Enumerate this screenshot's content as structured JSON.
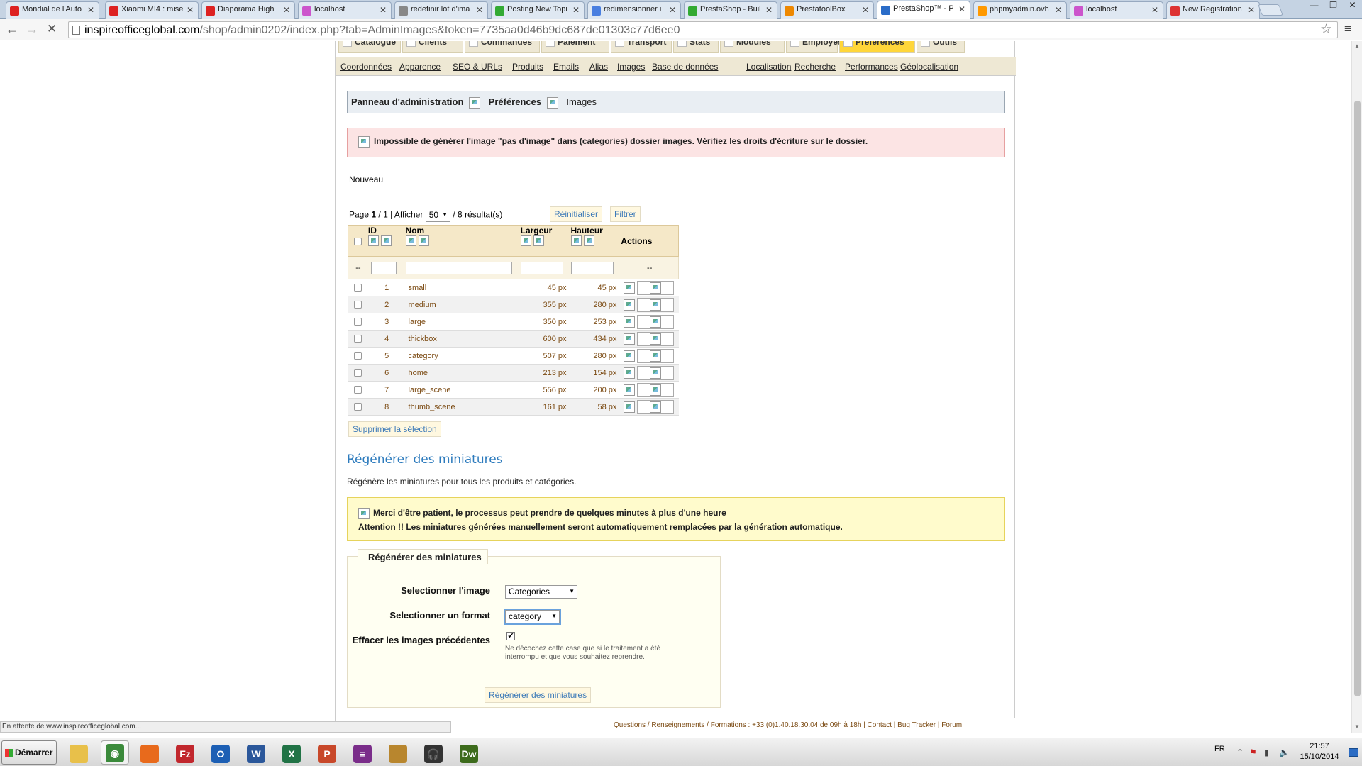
{
  "browser": {
    "tabs": [
      {
        "title": "Mondial de l'Auto",
        "favicon_color": "#d22"
      },
      {
        "title": "Xiaomi MI4 : mise",
        "favicon_color": "#d22"
      },
      {
        "title": "Diaporama High",
        "favicon_color": "#d22"
      },
      {
        "title": "localhost",
        "favicon_color": "#c5c"
      },
      {
        "title": "redefinir lot d'ima",
        "favicon_color": "#888"
      },
      {
        "title": "Posting New Topi",
        "favicon_color": "#3a3"
      },
      {
        "title": "redimensionner i",
        "favicon_color": "#4a7fe0"
      },
      {
        "title": "PrestaShop - Buil",
        "favicon_color": "#3a3"
      },
      {
        "title": "PrestatoolBox",
        "favicon_color": "#e80"
      },
      {
        "title": "PrestaShop™ - P",
        "favicon_color": "#2a6cc8"
      },
      {
        "title": "phpmyadmin.ovh",
        "favicon_color": "#f90"
      },
      {
        "title": "localhost",
        "favicon_color": "#c5c"
      },
      {
        "title": "New Registration",
        "favicon_color": "#d33"
      }
    ],
    "active_tab_index": 9,
    "close_glyph": "✕",
    "url_host": "inspireofficeglobal.com",
    "url_path": "/shop/admin0202/index.php?tab=AdminImages&token=7735aa0d46b9dc687de01303c77d6ee0",
    "status": "En attente de www.inspireofficeglobal.com..."
  },
  "admin": {
    "main_tabs": [
      "Catalogue",
      "Clients",
      "Commandes",
      "Paiement",
      "Transport",
      "Stats",
      "Modules",
      "Employés",
      "Préférences",
      "Outils"
    ],
    "active_main_tab": "Préférences",
    "sub_tabs": [
      "Coordonnées",
      "Apparence",
      "SEO & URLs",
      "Produits",
      "Emails",
      "Alias",
      "Images",
      "Base de données",
      "Localisation",
      "Recherche",
      "Performances",
      "Géolocalisation"
    ],
    "breadcrumb": [
      "Panneau d'administration",
      "Préférences",
      "Images"
    ],
    "error": "Impossible de générer l'image \"pas d'image\" dans (categories) dossier images. Vérifiez les droits d'écriture sur le dossier.",
    "new_link": "Nouveau",
    "pager": {
      "page_label": "Page",
      "page": "1",
      "pages": "/ 1 | Afficher",
      "per_page": "50",
      "results": "/ 8 résultat(s)",
      "reset": "Réinitialiser",
      "filter": "Filtrer"
    },
    "table": {
      "headers": {
        "id": "ID",
        "name": "Nom",
        "width": "Largeur",
        "height": "Hauteur",
        "actions": "Actions"
      },
      "filter_placeholder": "--",
      "rows": [
        {
          "id": "1",
          "name": "small",
          "width": "45 px",
          "height": "45 px"
        },
        {
          "id": "2",
          "name": "medium",
          "width": "355 px",
          "height": "280 px"
        },
        {
          "id": "3",
          "name": "large",
          "width": "350 px",
          "height": "253 px"
        },
        {
          "id": "4",
          "name": "thickbox",
          "width": "600 px",
          "height": "434 px"
        },
        {
          "id": "5",
          "name": "category",
          "width": "507 px",
          "height": "280 px"
        },
        {
          "id": "6",
          "name": "home",
          "width": "213 px",
          "height": "154 px"
        },
        {
          "id": "7",
          "name": "large_scene",
          "width": "556 px",
          "height": "200 px"
        },
        {
          "id": "8",
          "name": "thumb_scene",
          "width": "161 px",
          "height": "58 px"
        }
      ]
    },
    "delete_selection": "Supprimer la sélection",
    "regen": {
      "title": "Régénérer des miniatures",
      "description": "Régénère les miniatures pour tous les produits et catégories.",
      "warning_line1": "Merci d'être patient, le processus peut prendre de quelques minutes à plus d'une heure",
      "warning_line2": "Attention !! Les miniatures générées manuellement seront automatiquement remplacées par la génération automatique.",
      "legend": "Régénérer des miniatures",
      "label_image": "Selectionner l'image",
      "image_value": "Categories",
      "label_format": "Selectionner un format",
      "format_value": "category",
      "label_erase": "Effacer les images précédentes",
      "erase_checked": "✔",
      "hint": "Ne décochez cette case que si le traitement a été interrompu et que vous souhaitez reprendre.",
      "button": "Régénérer des miniatures"
    },
    "footer": "Questions / Renseignements / Formations : +33 (0)1.40.18.30.04 de 09h à 18h | Contact | Bug Tracker | Forum"
  },
  "taskbar": {
    "start": "Démarrer",
    "lang": "FR",
    "time": "21:57",
    "date": "15/10/2014",
    "apps": [
      {
        "name": "explorer",
        "color": "#e8c04a",
        "glyph": ""
      },
      {
        "name": "chrome",
        "color": "#3b8a3b",
        "glyph": "◉"
      },
      {
        "name": "firefox",
        "color": "#e86a1c",
        "glyph": ""
      },
      {
        "name": "filezilla",
        "color": "#c1272d",
        "glyph": "Fz"
      },
      {
        "name": "outlook",
        "color": "#1d5fb4",
        "glyph": "O"
      },
      {
        "name": "word",
        "color": "#2b579a",
        "glyph": "W"
      },
      {
        "name": "excel",
        "color": "#217346",
        "glyph": "X"
      },
      {
        "name": "powerpoint",
        "color": "#c8482a",
        "glyph": "P"
      },
      {
        "name": "winrar",
        "color": "#7a2d8a",
        "glyph": "≡"
      },
      {
        "name": "burger-app",
        "color": "#b8862e",
        "glyph": ""
      },
      {
        "name": "headphones-app",
        "color": "#333",
        "glyph": "🎧"
      },
      {
        "name": "dreamweaver",
        "color": "#3d6b1c",
        "glyph": "Dw"
      }
    ]
  }
}
